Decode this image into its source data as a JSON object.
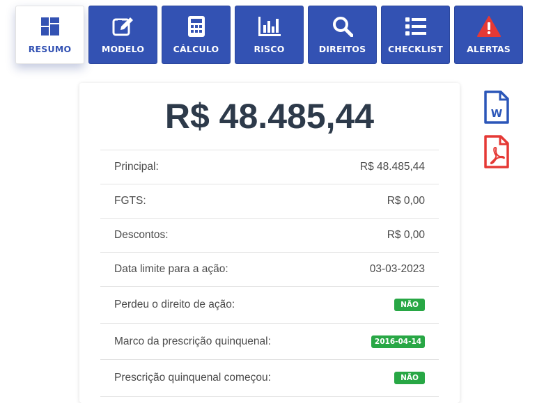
{
  "tabs": [
    {
      "label": "RESUMO",
      "icon": "dashboard-icon",
      "active": true
    },
    {
      "label": "MODELO",
      "icon": "edit-icon",
      "active": false
    },
    {
      "label": "CÁLCULO",
      "icon": "calculator-icon",
      "active": false
    },
    {
      "label": "RISCO",
      "icon": "bar-chart-icon",
      "active": false
    },
    {
      "label": "DIREITOS",
      "icon": "search-icon",
      "active": false
    },
    {
      "label": "CHECKLIST",
      "icon": "list-icon",
      "active": false
    },
    {
      "label": "ALERTAS",
      "icon": "warning-icon",
      "active": false
    }
  ],
  "summary": {
    "total": "R$ 48.485,44",
    "rows": [
      {
        "label": "Principal:",
        "value": "R$ 48.485,44"
      },
      {
        "label": "FGTS:",
        "value": "R$ 0,00"
      },
      {
        "label": "Descontos:",
        "value": "R$ 0,00"
      },
      {
        "label": "Data limite para a ação:",
        "value": "03-03-2023"
      },
      {
        "label": "Perdeu o direito de ação:",
        "badge": "NÃO"
      },
      {
        "label": "Marco da prescrição quinquenal:",
        "badge": "2016-04-14"
      },
      {
        "label": "Prescrição quinquenal começou:",
        "badge": "NÃO"
      }
    ]
  },
  "downloads": {
    "word_icon": "word-file-icon",
    "pdf_icon": "pdf-file-icon",
    "word_letter": "W"
  },
  "colors": {
    "tab_blue": "#3352b3",
    "badge_green": "#28a745",
    "word_blue": "#2b56b8",
    "pdf_red": "#e53935",
    "alert_red": "#e53935"
  }
}
